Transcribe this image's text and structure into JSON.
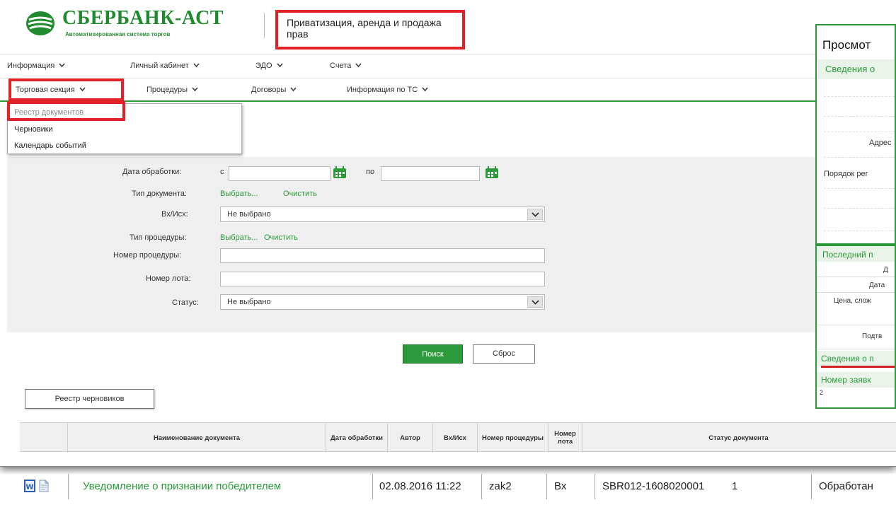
{
  "header": {
    "logo_title": "СБЕРБАНК-АСТ",
    "logo_subtitle": "Автоматизированная система торгов",
    "section_title": "Приватизация, аренда и продажа прав"
  },
  "nav_top": [
    {
      "label": "Информация"
    },
    {
      "label": "Личный кабинет"
    },
    {
      "label": "ЭДО"
    },
    {
      "label": "Счета"
    }
  ],
  "nav_main": [
    {
      "label": "Торговая секция"
    },
    {
      "label": "Процедуры"
    },
    {
      "label": "Договоры"
    },
    {
      "label": "Информация по ТС"
    }
  ],
  "dropdown": {
    "items": [
      {
        "label": "Реестр документов"
      },
      {
        "label": "Черновики"
      },
      {
        "label": "Календарь событий"
      }
    ]
  },
  "filter": {
    "date_label": "Дата обработки:",
    "date_from_prefix": "с",
    "date_to_prefix": "по",
    "doc_type_label": "Тип документа:",
    "doc_type_choose": "Выбрать...",
    "doc_type_clear": "Очистить",
    "direction_label": "Вх/Исх:",
    "direction_value": "Не выбрано",
    "proc_type_label": "Тип процедуры:",
    "proc_type_choose": "Выбрать...",
    "proc_type_clear": "Очистить",
    "proc_number_label": "Номер процедуры:",
    "lot_number_label": "Номер лота:",
    "status_label": "Статус:",
    "status_value": "Не выбрано"
  },
  "buttons": {
    "search": "Поиск",
    "reset": "Сброс",
    "drafts_registry": "Реестр черновиков"
  },
  "table": {
    "columns": [
      {
        "label": ""
      },
      {
        "label": "Наименование документа"
      },
      {
        "label": "Дата обработки"
      },
      {
        "label": "Автор"
      },
      {
        "label": "Вх/Исх"
      },
      {
        "label": "Номер процедуры"
      },
      {
        "label": "Номер лота"
      },
      {
        "label": "Статус документа"
      }
    ]
  },
  "panel": {
    "title": "Просмот",
    "subheader": "Сведения о",
    "address_fragment": "Адрес",
    "order_fragment": "Порядок рег"
  },
  "panel2": {
    "header": "Последний п",
    "row1": "Д",
    "row2": "Дата",
    "row3": "Цена, слож",
    "row4": "Подтв",
    "section2": "Сведения о п",
    "section3": "Номер заявк",
    "value": "2"
  },
  "result_row": {
    "doc_name": "Уведомление о признании победителем",
    "date": "02.08.2016 11:22",
    "author": "zak2",
    "direction": "Вх",
    "proc_number": "SBR012-1608020001",
    "lot": "1",
    "status": "Обработан"
  },
  "colors": {
    "brand_green": "#2c9a3a",
    "highlight_red": "#e32128"
  }
}
